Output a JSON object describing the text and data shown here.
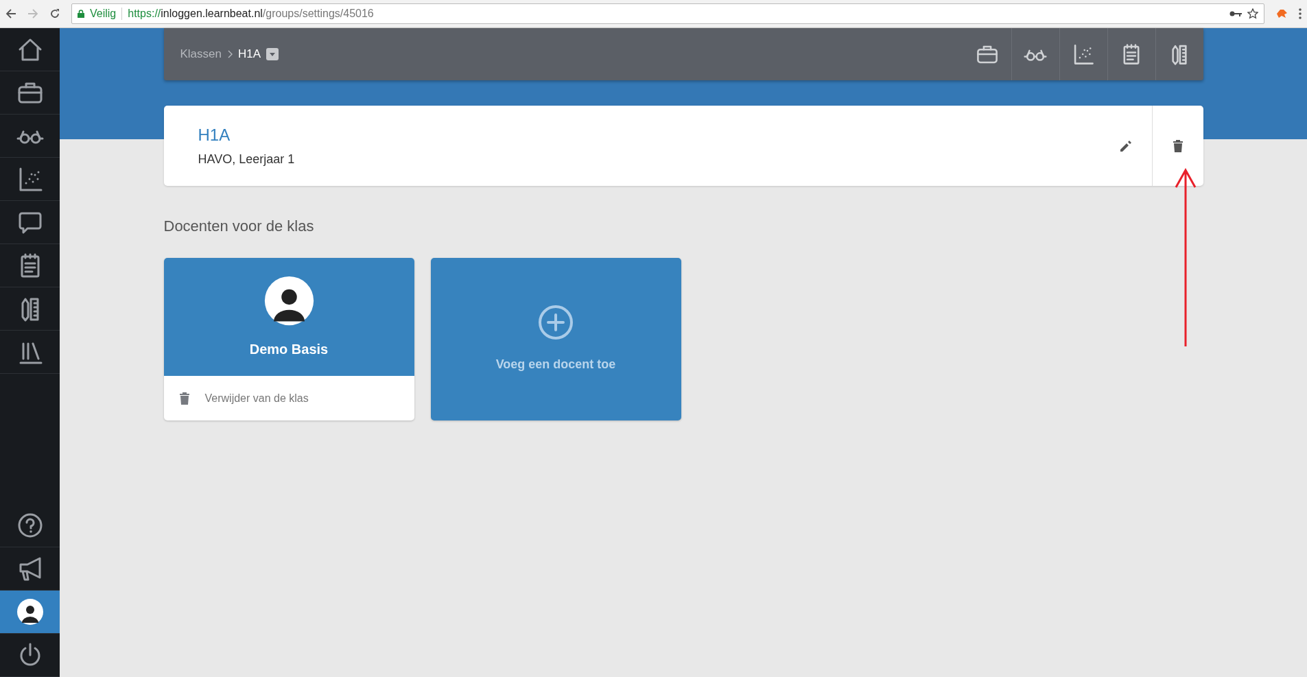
{
  "browser": {
    "secure_label": "Veilig",
    "url_scheme": "https://",
    "url_host": "inloggen.learnbeat.nl",
    "url_path": "/groups/settings/45016"
  },
  "sidebar": {
    "top": [
      {
        "selected": false
      },
      {
        "selected": false
      },
      {
        "selected": false
      },
      {
        "selected": false
      },
      {
        "selected": false
      },
      {
        "selected": false
      },
      {
        "selected": false
      },
      {
        "selected": false
      }
    ],
    "bottom": [
      {
        "selected": false
      },
      {
        "selected": false
      },
      {
        "selected": true
      },
      {
        "selected": false
      }
    ]
  },
  "breadcrumb": [
    "Klassen",
    "H1A"
  ],
  "group": {
    "title": "H1A",
    "subtitle": "HAVO, Leerjaar 1"
  },
  "teachers_heading": "Docenten voor de klas",
  "teachers": [
    {
      "name": "Demo Basis",
      "action": "Verwijder van de klas"
    }
  ],
  "add_teacher": "Voeg een docent toe"
}
